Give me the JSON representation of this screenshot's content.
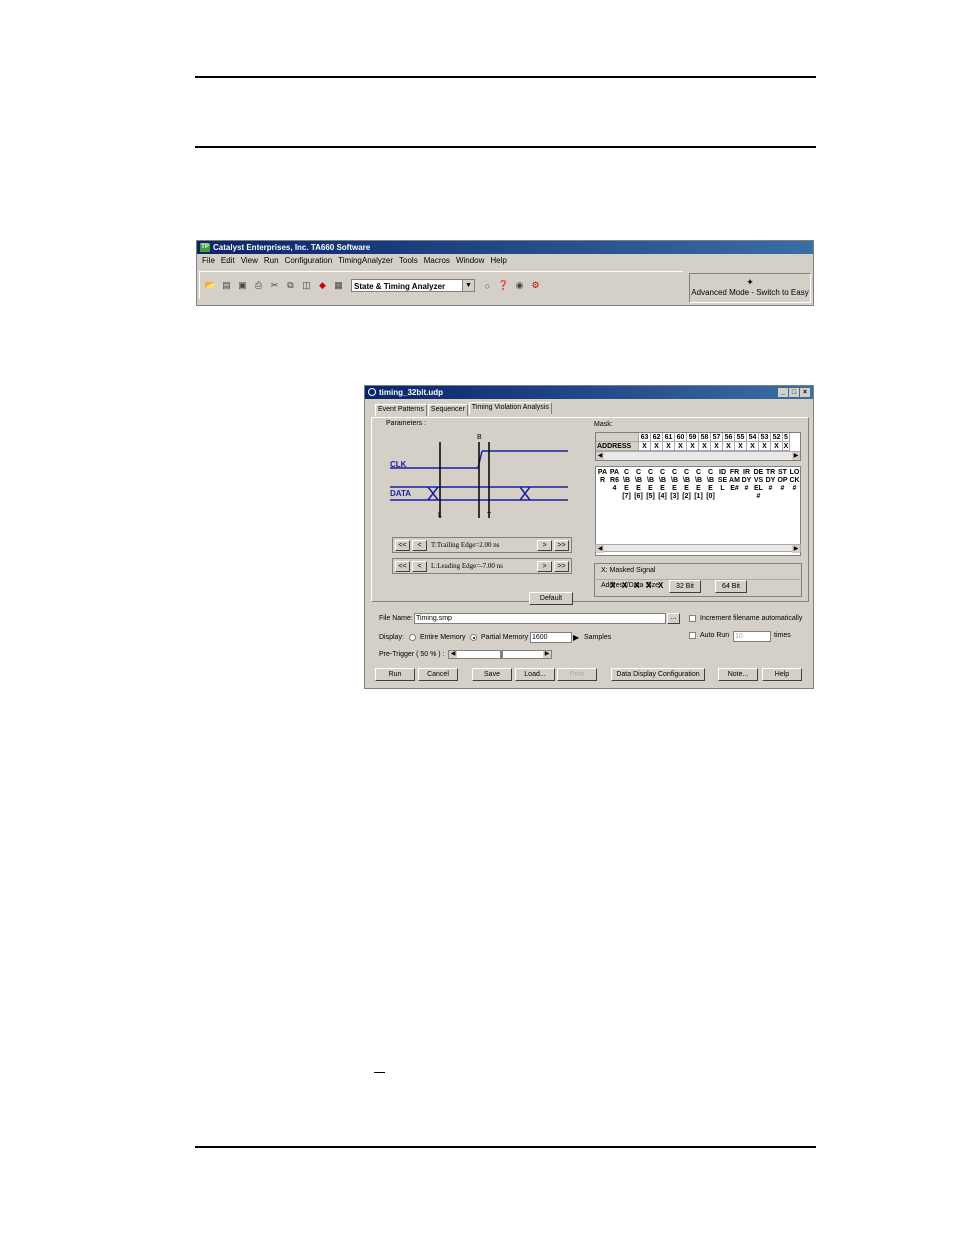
{
  "app": {
    "title": "Catalyst Enterprises, Inc. TA660 Software",
    "menu": [
      "File",
      "Edit",
      "View",
      "Run",
      "Configuration",
      "TimingAnalyzer",
      "Tools",
      "Macros",
      "Window",
      "Help"
    ],
    "analyzer_mode": "State & Timing Analyzer",
    "advanced_mode": "Advanced Mode - Switch to Easy"
  },
  "dialog": {
    "title": "timing_32bit.udp",
    "tabs": [
      "Event Patterns",
      "Sequencer",
      "Timing Violation Analysis"
    ],
    "parameters": {
      "legend": "Parameters :",
      "clk_label": "CLK",
      "data_label": "DATA",
      "marker_b": "B",
      "marker_l": "L",
      "marker_t": "T",
      "trailing_edge": "T:Trailing Edge=2.00 ns",
      "leading_edge": "L:Leading Edge=-7.00 ns",
      "nav_first": "<<",
      "nav_prev": "<",
      "nav_next": ">",
      "nav_last": ">>",
      "default_btn": "Default"
    },
    "mask": {
      "legend": "Mask:",
      "address_label": "ADDRESS",
      "address_bits": [
        "63",
        "62",
        "61",
        "60",
        "59",
        "58",
        "57",
        "56",
        "55",
        "54",
        "53",
        "52",
        "5"
      ],
      "address_marks": [
        "X",
        "X",
        "X",
        "X",
        "X",
        "X",
        "X",
        "X",
        "X",
        "X",
        "X",
        "X",
        "X"
      ],
      "signals": [
        "PAR",
        "PAR64",
        "C\\BE[7]",
        "C\\BE[6]",
        "C\\BE[5]",
        "C\\BE[4]",
        "C\\BE[3]",
        "C\\BE[2]",
        "C\\BE[1]",
        "C\\BE[0]",
        "IDSEL",
        "FRAME#",
        "IRDY#",
        "DEVSEL#",
        "TRDY#",
        "STOP#",
        "LOCK#"
      ],
      "signal_marks": [
        "X",
        "X",
        "X",
        "X",
        "X"
      ],
      "masked_note": "X:  Masked Signal",
      "size_label": "Address/Data Size",
      "btn_32": "32 Bit",
      "btn_64": "64 Bit"
    },
    "file": {
      "label": "File Name:",
      "value": "Timing.smp",
      "browse": "...",
      "increment_label": "Increment filename automatically",
      "display_label": "Display:",
      "entire_memory": "Entire Memory",
      "partial_memory": "Partial Memory",
      "samples_value": "1600",
      "samples_label": "Samples",
      "auto_run_label": "Auto Run",
      "auto_run_value": "10",
      "times_label": "times",
      "pretrigger_label": "Pre-Trigger ( 50 % ) :",
      "pretrigger_percent": 50
    },
    "buttons": [
      "Run",
      "Cancel",
      "Save",
      "Load...",
      "Print",
      "Data Display Configuration",
      "Note...",
      "Help"
    ]
  },
  "colors": {
    "titlebar": "#0a246a",
    "signal": "#1c1ca8",
    "face": "#d4d0c8"
  }
}
